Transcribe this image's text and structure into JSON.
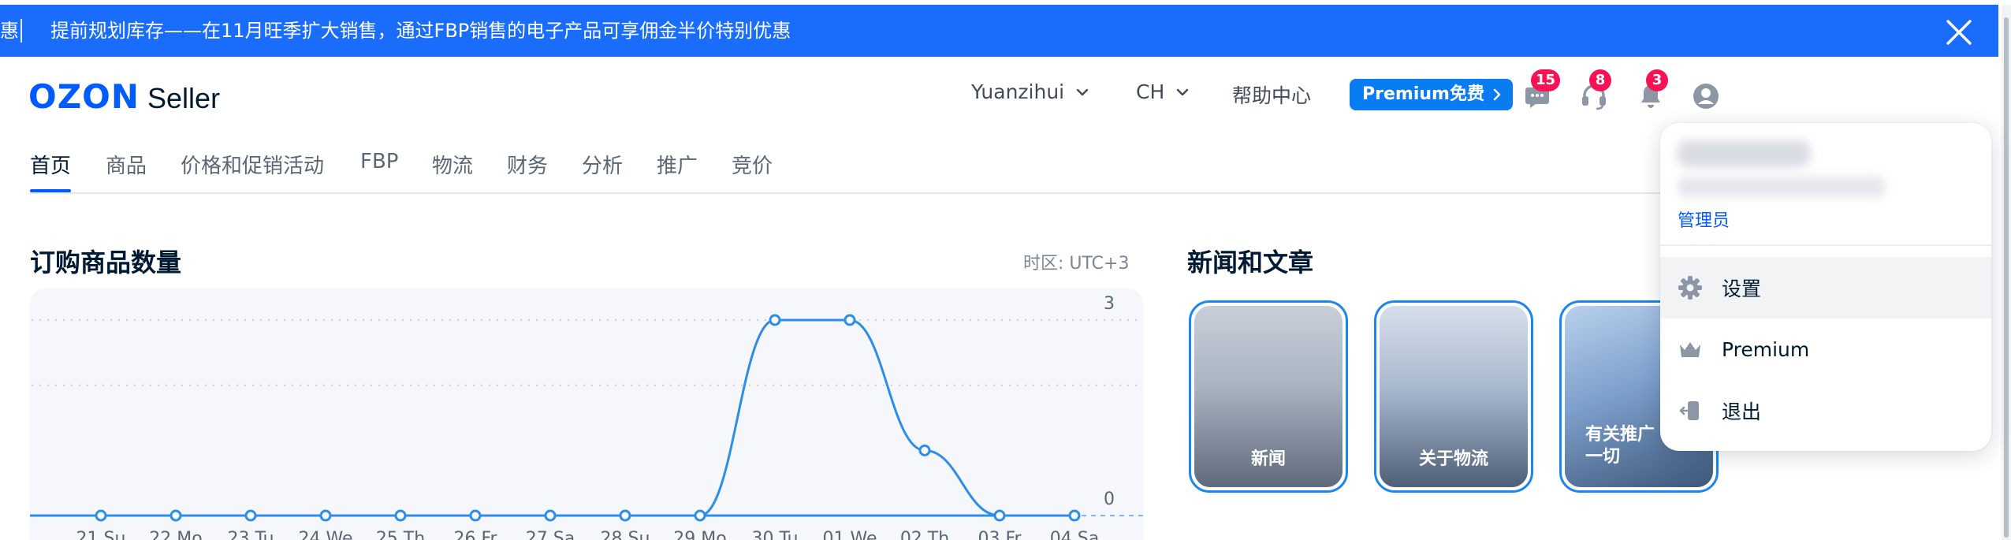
{
  "banner": {
    "cut_text": "惠",
    "message": "提前规划库存——在11月旺季扩大销售，通过FBP销售的电子产品可享佣金半价特别优惠"
  },
  "header": {
    "logo_text": "OZON",
    "logo_suffix": "Seller",
    "company": "Yuanzihui",
    "region": "CH",
    "help": "帮助中心",
    "premium": "Premium免费",
    "chat_badge": "15",
    "support_badge": "8",
    "notif_badge": "3"
  },
  "nav": {
    "tabs": [
      "首页",
      "商品",
      "价格和促销活动",
      "FBP",
      "物流",
      "财务",
      "分析",
      "推广",
      "竞价"
    ],
    "active": "首页"
  },
  "orders": {
    "title": "订购商品数量",
    "timezone": "时区:  UTC+3"
  },
  "news": {
    "title": "新闻和文章",
    "cards": [
      "新闻",
      "关于物流",
      "有关推广\n一切"
    ]
  },
  "account_menu": {
    "role": "管理员",
    "items": [
      "设置",
      "Premium",
      "退出"
    ]
  },
  "colors": {
    "brand": "#005bff",
    "banner": "#1a6cfb",
    "badge": "#f91155",
    "line": "#2d8de8",
    "premium_button": "#0a7cf2"
  },
  "chart_data": {
    "type": "line",
    "x": [
      "21 Su",
      "22 Mo",
      "23 Tu",
      "24 We",
      "25 Th",
      "26 Fr",
      "27 Sa",
      "28 Su",
      "29 Mo",
      "30 Tu",
      "01 We",
      "02 Th",
      "03 Fr",
      "04 Sa"
    ],
    "values": [
      0,
      0,
      0,
      0,
      0,
      0,
      0,
      0,
      0,
      3,
      3,
      1,
      0,
      0
    ],
    "ylim": [
      0,
      3
    ],
    "y_ticks": [
      "0",
      "3"
    ],
    "grid": true
  }
}
